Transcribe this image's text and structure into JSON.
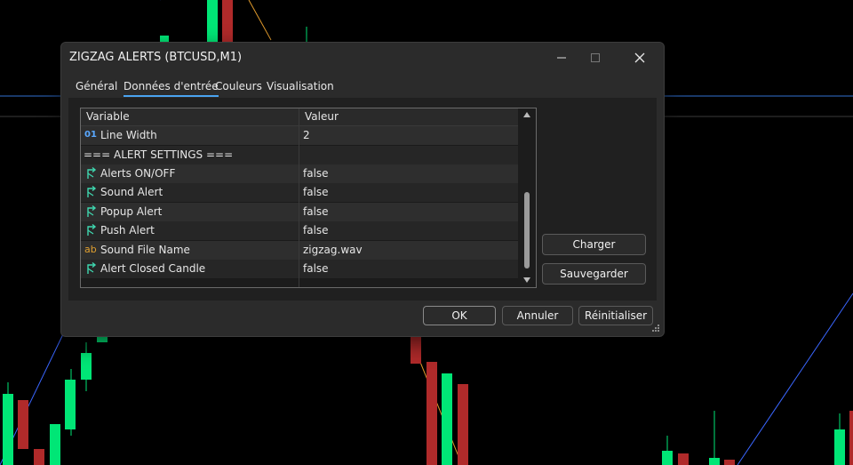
{
  "dialog": {
    "title": "ZIGZAG ALERTS (BTCUSD,M1)",
    "window_controls": {
      "minimize": "minimize-icon",
      "maximize": "maximize-icon",
      "close": "close-icon"
    }
  },
  "tabs": [
    {
      "label": "Général",
      "active": false
    },
    {
      "label": "Données d'entrée",
      "active": true
    },
    {
      "label": "Couleurs",
      "active": false
    },
    {
      "label": "Visualisation",
      "active": false
    }
  ],
  "table": {
    "headers": {
      "variable": "Variable",
      "value": "Valeur"
    },
    "rows": [
      {
        "icon": "int-icon",
        "icon_text": "01",
        "name": "Line Width",
        "value": "2"
      },
      {
        "icon": "none",
        "name": "=== ALERT SETTINGS ===",
        "value": ""
      },
      {
        "icon": "bool-icon",
        "name": "Alerts ON/OFF",
        "value": "false"
      },
      {
        "icon": "bool-icon",
        "name": "Sound Alert",
        "value": "false"
      },
      {
        "icon": "bool-icon",
        "name": "Popup Alert",
        "value": "false"
      },
      {
        "icon": "bool-icon",
        "name": "Push Alert",
        "value": "false"
      },
      {
        "icon": "string-icon",
        "icon_text": "ab",
        "name": "Sound File Name",
        "value": "zigzag.wav"
      },
      {
        "icon": "bool-icon",
        "name": "Alert Closed Candle",
        "value": "false"
      }
    ]
  },
  "side_buttons": {
    "load": "Charger",
    "save": "Sauvegarder"
  },
  "footer_buttons": {
    "ok": "OK",
    "cancel": "Annuler",
    "reset": "Réinitialiser"
  },
  "colors": {
    "chart_bg": "#000000",
    "bull_candle": "#00e676",
    "bear_candle": "#b02a2a",
    "zigzag_line": "#3a66ff",
    "level_line": "#2f6fd0",
    "orange_line": "#e09a2c",
    "tab_accent": "#4aa3f0"
  }
}
